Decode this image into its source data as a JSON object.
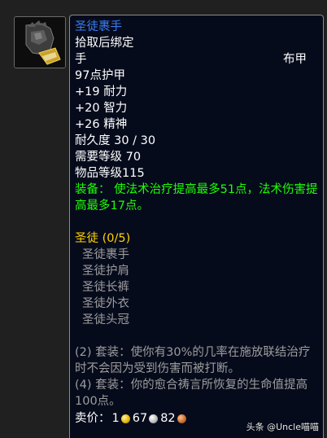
{
  "item": {
    "icon": "gauntlet-glove-icon",
    "name": "圣徒裹手",
    "bind": "拾取后绑定",
    "slot": "手",
    "armor_type": "布甲",
    "armor": "97点护甲",
    "stats": [
      "+19 耐力",
      "+20 智力",
      "+26 精神"
    ],
    "durability": "耐久度 30 / 30",
    "required_level": "需要等级 70",
    "item_level": "物品等级115",
    "equip_effect": "装备： 使法术治疗提高最多51点，法术伤害提高最多17点。"
  },
  "set": {
    "title": "圣徒 (0/5)",
    "pieces": [
      "圣徒裹手",
      "圣徒护肩",
      "圣徒长裤",
      "圣徒外衣",
      "圣徒头冠"
    ],
    "bonuses": [
      "(2) 套装：使你有30%的几率在施放联结治疗时不会因为受到伤害而被打断。",
      "(4) 套装：你的愈合祷言所恢复的生命值提高100点。"
    ]
  },
  "price": {
    "label": "卖价：",
    "gold": "1",
    "silver": "67",
    "copper": "82"
  },
  "colors": {
    "item_name": "#3b7cf0",
    "equip_green": "#1eff00",
    "set_title_gold": "#ffd100",
    "inactive_gray": "#9d9d9d",
    "tooltip_bg": "#060b1c"
  },
  "watermark": "头条 @Uncle喵喵"
}
